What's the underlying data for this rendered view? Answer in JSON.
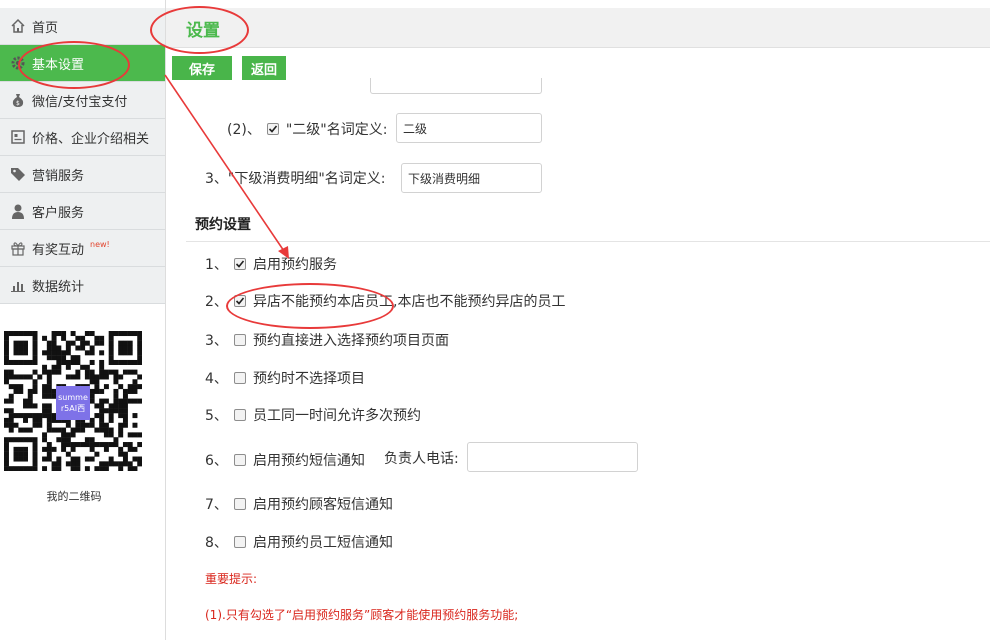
{
  "sidebar": {
    "items": [
      {
        "label": "首页",
        "icon": "home-icon"
      },
      {
        "label": "基本设置",
        "icon": "gear-icon",
        "active": true
      },
      {
        "label": "微信/支付宝支付",
        "icon": "money-bag-icon"
      },
      {
        "label": "价格、企业介绍相关",
        "icon": "document-icon"
      },
      {
        "label": "营销服务",
        "icon": "tag-icon"
      },
      {
        "label": "客户服务",
        "icon": "person-icon"
      },
      {
        "label": "有奖互动",
        "icon": "gift-icon",
        "badge": "new!"
      },
      {
        "label": "数据统计",
        "icon": "bar-chart-icon"
      }
    ],
    "qr_center_text": "summe r5AI西",
    "qr_caption": "我的二维码"
  },
  "header": {
    "title": "设置"
  },
  "toolbar": {
    "save_label": "保存",
    "back_label": "返回"
  },
  "naming": {
    "level2_prefix": "(2)、",
    "level2_label": "\"二级\"名词定义:",
    "level2_value": "二级",
    "level2_checked": true,
    "detail_label": "3、\"下级消费明细\"名词定义:",
    "detail_value": "下级消费明细"
  },
  "booking": {
    "section_title": "预约设置",
    "options": [
      {
        "num": "1、",
        "label": "启用预约服务",
        "checked": true
      },
      {
        "num": "2、",
        "label": "异店不能预约本店员工,本店也不能预约异店的员工",
        "checked": true
      },
      {
        "num": "3、",
        "label": "预约直接进入选择预约项目页面",
        "checked": false
      },
      {
        "num": "4、",
        "label": "预约时不选择项目",
        "checked": false
      },
      {
        "num": "5、",
        "label": "员工同一时间允许多次预约",
        "checked": false
      },
      {
        "num": "6、",
        "label": "启用预约短信通知",
        "checked": false
      },
      {
        "num": "7、",
        "label": "启用预约顾客短信通知",
        "checked": false
      },
      {
        "num": "8、",
        "label": "启用预约员工短信通知",
        "checked": false
      }
    ],
    "phone_label": "负责人电话:",
    "phone_value": ""
  },
  "notes": {
    "title": "重要提示:",
    "line1": "(1).只有勾选了“启用预约服务”顾客才能使用预约服务功能;"
  },
  "colors": {
    "accent": "#4cb94d",
    "warning": "#d9261c",
    "annotation": "#e83a3a"
  }
}
